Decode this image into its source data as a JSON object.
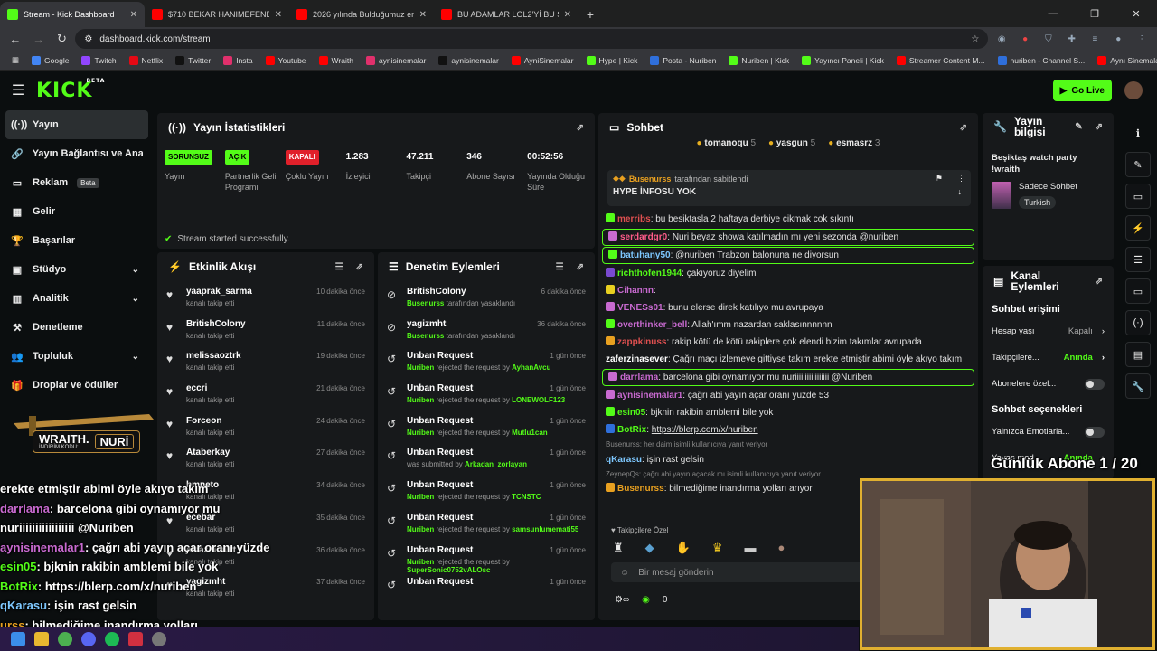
{
  "browser": {
    "tabs": [
      {
        "title": "Stream - Kick Dashboard",
        "active": true,
        "color": "#53fc18"
      },
      {
        "title": "$710 BEKAR HANIMEFENDİNİN",
        "active": false,
        "color": "#ff0000"
      },
      {
        "title": "2026 yılında Bulduğumuz en iyi",
        "active": false,
        "color": "#ff0000"
      },
      {
        "title": "BU ADAMLAR LOL2'Yİ BU SEFE",
        "active": false,
        "color": "#ff0000"
      }
    ],
    "url": "dashboard.kick.com/stream",
    "bookmarks": [
      {
        "label": "Google",
        "color": "#4285f4"
      },
      {
        "label": "Twitch",
        "color": "#9146ff"
      },
      {
        "label": "Netflix",
        "color": "#e50914"
      },
      {
        "label": "Twitter",
        "color": "#111111"
      },
      {
        "label": "Insta",
        "color": "#e1306c"
      },
      {
        "label": "Youtube",
        "color": "#ff0000"
      },
      {
        "label": "Wraith",
        "color": "#ff0000"
      },
      {
        "label": "aynisinemalar",
        "color": "#e1306c"
      },
      {
        "label": "aynisinemalar",
        "color": "#111111"
      },
      {
        "label": "AyniSinemalar",
        "color": "#ff0000"
      },
      {
        "label": "Hype | Kick",
        "color": "#53fc18"
      },
      {
        "label": "Posta - Nuriben",
        "color": "#2f6fdb"
      },
      {
        "label": "Nuriben | Kick",
        "color": "#53fc18"
      },
      {
        "label": "Yayıncı Paneli | Kick",
        "color": "#53fc18"
      },
      {
        "label": "Streamer Content M...",
        "color": "#ff0000"
      },
      {
        "label": "nuriben - Channel S...",
        "color": "#2f6fdb"
      },
      {
        "label": "Aynı Sinemalar - Ça...",
        "color": "#ff0000"
      }
    ]
  },
  "header": {
    "logo": "KICK",
    "logo_sup": "BETA",
    "go_live": "Go Live"
  },
  "sidebar": {
    "items": [
      {
        "label": "Yayın",
        "icon": "broadcast-icon",
        "glyph": "((·))",
        "active": true,
        "chev": false
      },
      {
        "label": "Yayın Bağlantısı ve Anahtarı",
        "icon": "link-icon",
        "glyph": "🔗",
        "active": false,
        "chev": false
      },
      {
        "label": "Reklam",
        "icon": "ad-icon",
        "glyph": "▭",
        "active": false,
        "chev": false,
        "badge": "Beta"
      },
      {
        "label": "Gelir",
        "icon": "money-icon",
        "glyph": "▦",
        "active": false,
        "chev": false
      },
      {
        "label": "Başarılar",
        "icon": "trophy-icon",
        "glyph": "🏆",
        "active": false,
        "chev": false
      },
      {
        "label": "Stüdyo",
        "icon": "studio-icon",
        "glyph": "▣",
        "active": false,
        "chev": true
      },
      {
        "label": "Analitik",
        "icon": "chart-icon",
        "glyph": "▥",
        "active": false,
        "chev": true
      },
      {
        "label": "Denetleme",
        "icon": "hammer-icon",
        "glyph": "⚒",
        "active": false,
        "chev": false
      },
      {
        "label": "Topluluk",
        "icon": "community-icon",
        "glyph": "👥",
        "active": false,
        "chev": true
      },
      {
        "label": "Droplar ve ödüller",
        "icon": "gift-icon",
        "glyph": "🎁",
        "active": false,
        "chev": false
      }
    ]
  },
  "stats": {
    "title": "Yayın İstatistikleri",
    "items": [
      {
        "value": "SORUNSUZ",
        "label": "Yayın",
        "badge": true,
        "bg": "#53fc18",
        "fg": "#000"
      },
      {
        "value": "AÇIK",
        "label": "Partnerlik Gelir Programı",
        "badge": true,
        "bg": "#53fc18",
        "fg": "#000"
      },
      {
        "value": "KAPALI",
        "label": "Çoklu Yayın",
        "badge": true,
        "bg": "#e0202a",
        "fg": "#fff"
      },
      {
        "value": "1.283",
        "label": "İzleyici",
        "badge": false
      },
      {
        "value": "47.211",
        "label": "Takipçi",
        "badge": false
      },
      {
        "value": "346",
        "label": "Abone Sayısı",
        "badge": false
      },
      {
        "value": "00:52:56",
        "label": "Yayında Olduğu Süre",
        "badge": false
      }
    ],
    "success": "Stream started successfully."
  },
  "activity": {
    "title": "Etkinlik Akışı",
    "rows": [
      {
        "name": "yaaprak_sarma",
        "sub": "kanalı takip etti",
        "time": "10 dakika önce"
      },
      {
        "name": "BritishColony",
        "sub": "kanalı takip etti",
        "time": "11 dakika önce"
      },
      {
        "name": "melissaoztrk",
        "sub": "kanalı takip etti",
        "time": "19 dakika önce"
      },
      {
        "name": "eccri",
        "sub": "kanalı takip etti",
        "time": "21 dakika önce"
      },
      {
        "name": "Forceon",
        "sub": "kanalı takip etti",
        "time": "24 dakika önce"
      },
      {
        "name": "Ataberkay",
        "sub": "kanalı takip etti",
        "time": "27 dakika önce"
      },
      {
        "name": "hmneto",
        "sub": "kanalı takip etti",
        "time": "34 dakika önce"
      },
      {
        "name": "ecebar",
        "sub": "kanalı takip etti",
        "time": "35 dakika önce"
      },
      {
        "name": "elsaziumutt",
        "sub": "kanalı takip etti",
        "time": "36 dakika önce"
      },
      {
        "name": "yagizmht",
        "sub": "kanalı takip etti",
        "time": "37 dakika önce"
      }
    ]
  },
  "moderation": {
    "title": "Denetim Eylemleri",
    "rows": [
      {
        "name": "BritishColony",
        "actor": "Busenurss",
        "rest": "tarafından yasaklandı",
        "other": "",
        "time": "6 dakika önce",
        "icon": "ban-icon",
        "glyph": "⊘"
      },
      {
        "name": "yagizmht",
        "actor": "Busenurss",
        "rest": "tarafından yasaklandı",
        "other": "",
        "time": "36 dakika önce",
        "icon": "ban-icon",
        "glyph": "⊘"
      },
      {
        "name": "Unban Request",
        "actor": "Nuriben",
        "rest": "rejected the request by",
        "other": "AyhanAvcu",
        "time": "1 gün önce",
        "icon": "history-icon",
        "glyph": "↺"
      },
      {
        "name": "Unban Request",
        "actor": "Nuriben",
        "rest": "rejected the request by",
        "other": "LONEWOLF123",
        "time": "1 gün önce",
        "icon": "history-icon",
        "glyph": "↺"
      },
      {
        "name": "Unban Request",
        "actor": "Nuriben",
        "rest": "rejected the request by",
        "other": "Mutlu1can",
        "time": "1 gün önce",
        "icon": "history-icon",
        "glyph": "↺"
      },
      {
        "name": "Unban Request",
        "actor": "",
        "rest": "was submitted by",
        "other": "Arkadan_zorlayan",
        "time": "1 gün önce",
        "icon": "history-icon",
        "glyph": "↺"
      },
      {
        "name": "Unban Request",
        "actor": "Nuriben",
        "rest": "rejected the request by",
        "other": "TCNSTC",
        "time": "1 gün önce",
        "icon": "history-icon",
        "glyph": "↺"
      },
      {
        "name": "Unban Request",
        "actor": "Nuriben",
        "rest": "rejected the request by",
        "other": "samsunlumemati55",
        "time": "1 gün önce",
        "icon": "history-icon",
        "glyph": "↺"
      },
      {
        "name": "Unban Request",
        "actor": "Nuriben",
        "rest": "rejected the request by",
        "other": "SuperSonic0752vALOsc",
        "time": "1 gün önce",
        "icon": "history-icon",
        "glyph": "↺"
      },
      {
        "name": "Unban Request",
        "actor": "",
        "rest": "",
        "other": "",
        "time": "1 gün önce",
        "icon": "history-icon",
        "glyph": "↺"
      }
    ]
  },
  "chat": {
    "title": "Sohbet",
    "top_gifters": [
      {
        "name": "tomanoqu",
        "count": "5"
      },
      {
        "name": "yasgun",
        "count": "5"
      },
      {
        "name": "esmasrz",
        "count": "3"
      }
    ],
    "pinned": {
      "by": "Busenurss",
      "by_rest": "tarafından sabitlendi",
      "text": "HYPE İNFOSU YOK"
    },
    "messages": [
      {
        "user": "merribs",
        "color": "#e05050",
        "text": "bu besiktasla 2 haftaya derbiye cikmak cok sıkıntı",
        "hl": false,
        "badge": "#53fc18"
      },
      {
        "user": "serdardgr0",
        "color": "#ff5c8a",
        "text": "Nuri beyaz showa katılmadın mı yeni sezonda @nuriben",
        "hl": true,
        "badge": "#c86ad0"
      },
      {
        "user": "batuhany50",
        "color": "#7ec8ff",
        "text": "@nuriben Trabzon balonuna ne diyorsun",
        "hl": true,
        "badge": "#53fc18"
      },
      {
        "user": "richthofen1944",
        "color": "#53fc18",
        "text": "çakıyoruz diyelim",
        "hl": false,
        "badge": "#7a4ad0"
      },
      {
        "user": "Cihannn",
        "color": "#c86ad0",
        "text": "",
        "hl": false,
        "badge": "#e8d020"
      },
      {
        "user": "VENESs01",
        "color": "#c86ad0",
        "text": "bunu elerse direk katılıyo mu avrupaya",
        "hl": false,
        "badge": "#c86ad0"
      },
      {
        "user": "overthinker_bell",
        "color": "#c86ad0",
        "text": "Allah'ımm nazardan saklasınnnnnn",
        "hl": false,
        "badge": "#53fc18"
      },
      {
        "user": "zappkinuss",
        "color": "#e05050",
        "text": "rakip kötü de kötü rakiplere çok elendi bizim takımlar avrupada",
        "hl": false,
        "badge": "#e8a020"
      },
      {
        "user": "zaferzinasever",
        "color": "#ffffff",
        "text": "Çağrı maçı izlemeye gittiyse takım erekte etmiştir abimi öyle akıyo takım",
        "hl": false,
        "badge": ""
      },
      {
        "user": "darrlama",
        "color": "#c86ad0",
        "text": "barcelona gibi oynamıyor mu nuriiiiiiiiiiiiiiiii @Nuriben",
        "hl": true,
        "badge": "#c86ad0"
      },
      {
        "user": "aynisinemalar1",
        "color": "#c86ad0",
        "text": "çağrı abi yayın açar oranı yüzde 53",
        "hl": false,
        "badge": "#c86ad0"
      },
      {
        "user": "esin05",
        "color": "#53fc18",
        "text": "bjknin rakibin amblemi bile yok",
        "hl": false,
        "badge": "#53fc18"
      },
      {
        "user": "BotRix",
        "color": "#53fc18",
        "text": "https://blerp.com/x/nuriben",
        "hl": false,
        "badge": "#2f6fdb"
      },
      {
        "user": "qKarasu",
        "color": "#7ec8ff",
        "text": "işin rast gelsin",
        "hl": false,
        "badge": "",
        "reply": "Busenurss: her daim isimli kullanıcıya yanıt veriyor"
      },
      {
        "user": "Busenurss",
        "color": "#e8a020",
        "text": "bilmediğime inandırma yolları arıyor",
        "hl": false,
        "badge": "#e8a020",
        "reply": "ZeynepQs: çağrı abi yayın açacak mı isimli kullanıcıya yanıt veriyor"
      }
    ],
    "follower_only": "Takipçilere Özel",
    "input_placeholder": "Bir mesaj gönderin",
    "points": "0"
  },
  "stream_info": {
    "title": "Yayın bilgisi",
    "stream_title": "Beşiktaş watch party !wraith",
    "category": "Sadece Sohbet",
    "language": "Turkish"
  },
  "channel_actions": {
    "title": "Kanal Eylemleri",
    "chat_access": "Sohbet erişimi",
    "rows": [
      {
        "label": "Hesap yaşı",
        "value": "Kapalı",
        "on": false,
        "type": "link"
      },
      {
        "label": "Takipçilere...",
        "value": "Anında",
        "on": true,
        "type": "link"
      },
      {
        "label": "Abonelere özel...",
        "value": "",
        "on": false,
        "type": "toggle"
      }
    ],
    "chat_options": "Sohbet seçenekleri",
    "rows2": [
      {
        "label": "Yalnızca Emotlarla...",
        "value": "",
        "on": false,
        "type": "toggle"
      },
      {
        "label": "Yavaş mod",
        "value": "Anında",
        "on": true,
        "type": "link"
      }
    ]
  },
  "overlay": {
    "daily_sub": "Günlük Abone 1 / 20",
    "wraith_name": "WRAITH.",
    "wraith_code_label": "İNDİRİM KODU:",
    "wraith_code": "NURİ",
    "chat": [
      {
        "user": "",
        "text": "erekte etmiştir abimi öyle akıyo takım",
        "color": "#fff"
      },
      {
        "user": "darrlama",
        "text": ": barcelona gibi oynamıyor mu",
        "color": "#c86ad0"
      },
      {
        "user": "",
        "text": "nuriiiiiiiiiiiiiiiii @Nuriben",
        "color": "#fff"
      },
      {
        "user": "aynisinemalar1",
        "text": ": çağrı abi yayın açar oranı yüzde 53",
        "color": "#c86ad0"
      },
      {
        "user": "esin05",
        "text": ": bjknin rakibin amblemi bile yok",
        "color": "#53fc18"
      },
      {
        "user": "BotRix",
        "text": ": https://blerp.com/x/nuriben",
        "color": "#53fc18"
      },
      {
        "user": "qKarasu",
        "text": ": işin rast gelsin",
        "color": "#7ec8ff"
      },
      {
        "user": "urss",
        "text": ": bilmediğime inandırma yolları",
        "color": "#e8a020"
      }
    ]
  }
}
